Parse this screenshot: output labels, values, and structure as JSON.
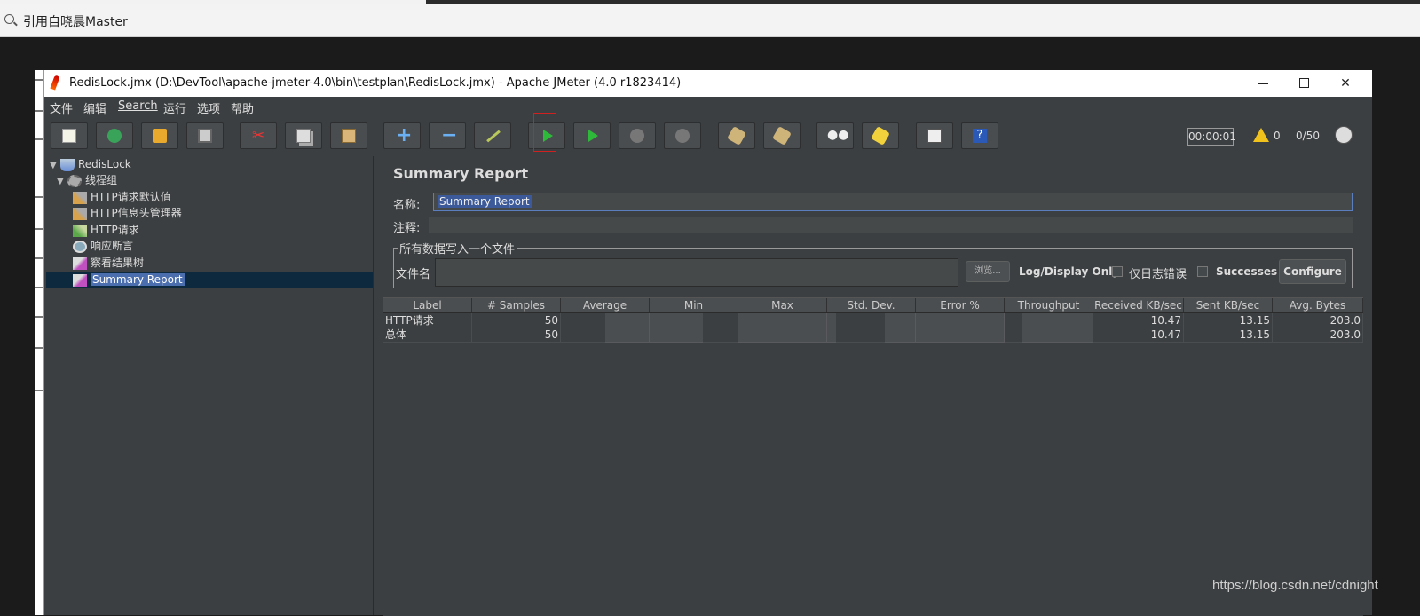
{
  "browser": {
    "search_text": "引用自晓晨Master"
  },
  "window": {
    "title": "RedisLock.jmx (D:\\DevTool\\apache-jmeter-4.0\\bin\\testplan\\RedisLock.jmx) - Apache JMeter (4.0 r1823414)"
  },
  "menu": [
    "文件",
    "编辑",
    "Search",
    "运行",
    "选项",
    "帮助"
  ],
  "toolbar": {
    "icons": [
      "new-icon",
      "templates-icon",
      "open-icon",
      "save-icon",
      "cut-icon",
      "copy-icon",
      "paste-icon",
      "expand-icon",
      "collapse-icon",
      "toggle-icon",
      "start-icon",
      "start-no-pauses-icon",
      "stop-icon",
      "shutdown-icon",
      "clear-icon",
      "clear-all-icon",
      "search-icon",
      "reset-search-icon",
      "function-helper-icon",
      "help-icon"
    ],
    "timer": "00:00:01",
    "warning_count": "0",
    "threads": "0/50"
  },
  "tree": {
    "nodes": [
      {
        "label": "RedisLock",
        "icon": "test-plan-icon"
      },
      {
        "label": "线程组",
        "icon": "thread-group-icon"
      },
      {
        "label": "HTTP请求默认值",
        "icon": "config-icon"
      },
      {
        "label": "HTTP信息头管理器",
        "icon": "config-icon"
      },
      {
        "label": "HTTP请求",
        "icon": "sampler-icon"
      },
      {
        "label": "响应断言",
        "icon": "assertion-icon"
      },
      {
        "label": "察看结果树",
        "icon": "listener-icon"
      },
      {
        "label": "Summary Report",
        "icon": "listener-icon"
      }
    ]
  },
  "panel": {
    "title": "Summary Report",
    "name_label": "名称:",
    "name_value": "Summary Report",
    "comment_label": "注释:",
    "fileset_legend": "所有数据写入一个文件",
    "filename_label": "文件名",
    "browse_label": "浏览...",
    "log_display_only": "Log/Display Only:",
    "errors_label": "仅日志错误",
    "successes_label": "Successes",
    "configure_label": "Configure"
  },
  "table": {
    "columns": [
      "Label",
      "# Samples",
      "Average",
      "Min",
      "Max",
      "Std. Dev.",
      "Error %",
      "Throughput",
      "Received KB/sec",
      "Sent KB/sec",
      "Avg. Bytes"
    ],
    "rows": [
      [
        "HTTP请求",
        "50",
        "",
        "",
        "",
        "",
        "",
        "",
        "10.47",
        "13.15",
        "203.0"
      ],
      [
        "总体",
        "50",
        "",
        "",
        "",
        "",
        "",
        "",
        "10.47",
        "13.15",
        "203.0"
      ]
    ]
  },
  "watermark": "https://blog.csdn.net/cdnight"
}
